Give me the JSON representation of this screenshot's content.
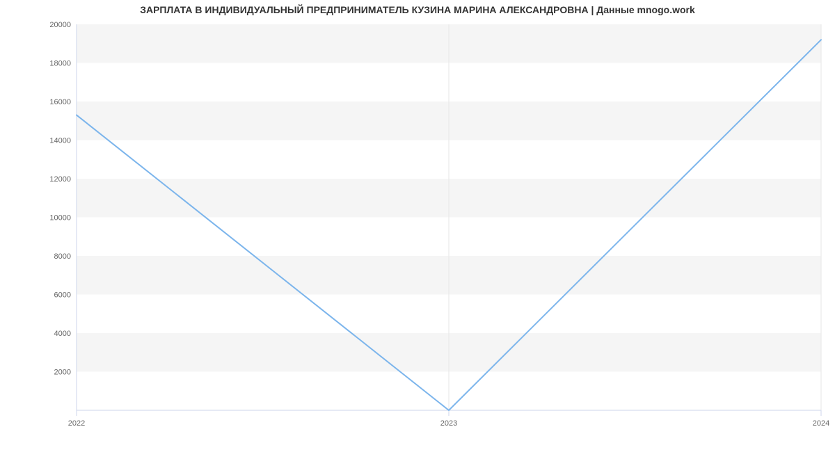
{
  "chart_data": {
    "type": "line",
    "title": "ЗАРПЛАТА В ИНДИВИДУАЛЬНЫЙ ПРЕДПРИНИМАТЕЛЬ КУЗИНА МАРИНА АЛЕКСАНДРОВНА | Данные mnogo.work",
    "x": [
      2022,
      2023,
      2024
    ],
    "values": [
      15300,
      0,
      19200
    ],
    "xlabel": "",
    "ylabel": "",
    "x_ticks": [
      2022,
      2023,
      2024
    ],
    "y_ticks": [
      2000,
      4000,
      6000,
      8000,
      10000,
      12000,
      14000,
      16000,
      18000,
      20000
    ],
    "xlim": [
      2022,
      2024
    ],
    "ylim": [
      0,
      20000
    ],
    "line_color": "#7cb5ec"
  }
}
